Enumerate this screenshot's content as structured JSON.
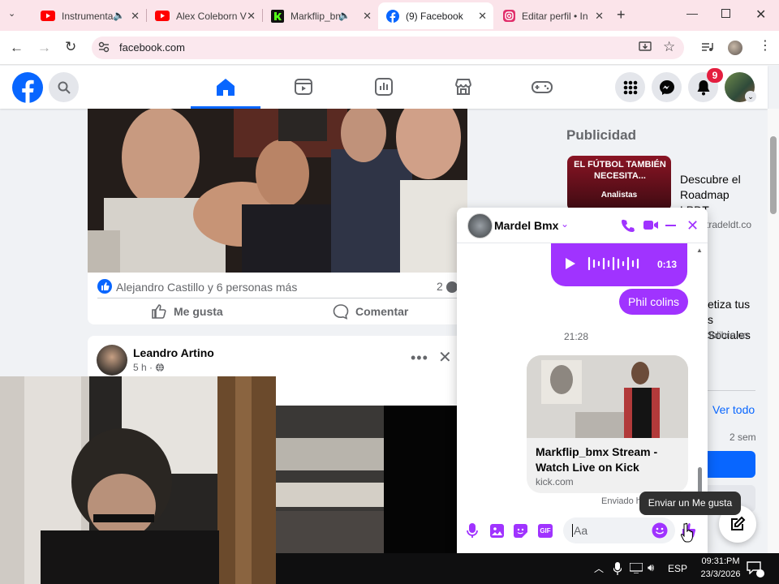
{
  "browser": {
    "tabs": [
      {
        "label": "Instrumenta",
        "icon": "youtube-icon"
      },
      {
        "label": "Alex Coleborn V",
        "icon": "youtube-icon"
      },
      {
        "label": "Markflip_bm",
        "icon": "kick-icon"
      },
      {
        "label": "(9) Facebook",
        "icon": "facebook-icon"
      },
      {
        "label": "Editar perfil • In",
        "icon": "instagram-icon"
      }
    ],
    "url": "facebook.com"
  },
  "header": {
    "notifications_count": "9"
  },
  "feed": {
    "post1": {
      "reactions": "Alejandro Castillo y 6 personas más",
      "comments_count": "2",
      "like_label": "Me gusta",
      "comment_label": "Comentar"
    },
    "post2": {
      "author": "Leandro Artino",
      "time": "5 h ·"
    }
  },
  "sidebar": {
    "ads_title": "Publicidad",
    "ad1": {
      "image_text": "EL FÚTBOL TAMBIÉN NECESITA...",
      "image_sub": "Analistas",
      "title": "Descubre el Roadmap LPDT",
      "domain": "tradeldt.co"
    },
    "ad2": {
      "title": "etiza tus s Sociales",
      "domain": "dolibre.co"
    },
    "see_all": "Ver todo",
    "age": "2 sem"
  },
  "chat": {
    "contact": "Mardel Bmx",
    "audio_duration": "0:13",
    "sent_text": "Phil colins",
    "timestamp": "21:28",
    "link_title": "Markflip_bmx Stream - Watch Live on Kick",
    "link_domain": "kick.com",
    "sent_status": "Enviado h",
    "input_placeholder": "Aa",
    "tooltip": "Enviar un Me gusta"
  },
  "taskbar": {
    "language": "ESP",
    "time": "09:31:PM",
    "date": "23/3/2026"
  },
  "colors": {
    "facebook_blue": "#0866ff",
    "messenger_purple": "#a033ff",
    "tab_bar": "#fbe4ea"
  }
}
